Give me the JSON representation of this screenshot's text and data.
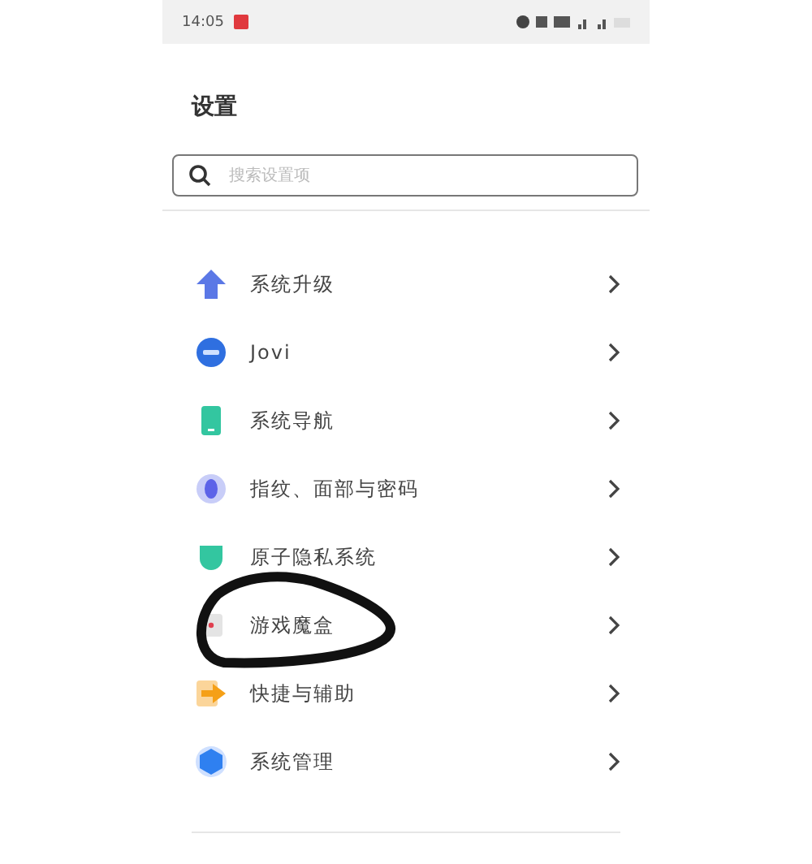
{
  "status_bar": {
    "time": "14:05"
  },
  "title": "设置",
  "search": {
    "placeholder": "搜索设置项"
  },
  "items": [
    {
      "label": "系统升级",
      "kind": "upgrade"
    },
    {
      "label": "Jovi",
      "kind": "jovi"
    },
    {
      "label": "系统导航",
      "kind": "navigation"
    },
    {
      "label": "指纹、面部与密码",
      "kind": "fingerprint"
    },
    {
      "label": "原子隐私系统",
      "kind": "privacy"
    },
    {
      "label": "游戏魔盒",
      "kind": "game"
    },
    {
      "label": "快捷与辅助",
      "kind": "shortcut"
    },
    {
      "label": "系统管理",
      "kind": "management"
    }
  ]
}
